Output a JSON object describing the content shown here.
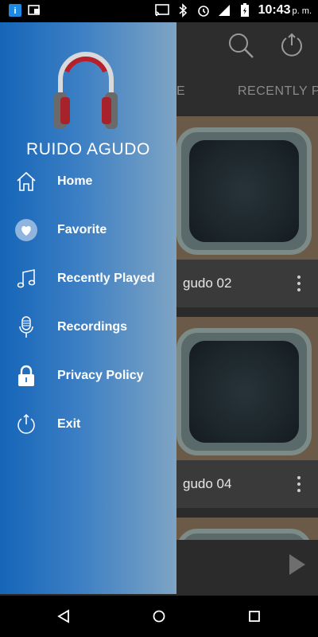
{
  "status_bar": {
    "time": "10:43",
    "ampm": "p. m.",
    "icons": [
      "info-icon",
      "image-notification-icon",
      "cast-icon",
      "bluetooth-icon",
      "alarm-icon",
      "signal-icon",
      "battery-charging-icon"
    ]
  },
  "app": {
    "tabs": [
      "E",
      "RECENTLY PL"
    ],
    "cards": [
      {
        "title": "gudo 02"
      },
      {
        "title": "gudo 04"
      }
    ]
  },
  "drawer": {
    "title": "RUIDO AGUDO",
    "logo_icon": "headphones-icon",
    "items": [
      {
        "label": "Home",
        "icon": "home-icon"
      },
      {
        "label": "Favorite",
        "icon": "heart-icon"
      },
      {
        "label": "Recently Played",
        "icon": "music-note-icon"
      },
      {
        "label": "Recordings",
        "icon": "microphone-icon"
      },
      {
        "label": "Privacy Policy",
        "icon": "lock-icon"
      },
      {
        "label": "Exit",
        "icon": "power-icon"
      }
    ]
  },
  "navbar": {
    "buttons": [
      "back-icon",
      "home-circle-icon",
      "recents-square-icon"
    ]
  }
}
